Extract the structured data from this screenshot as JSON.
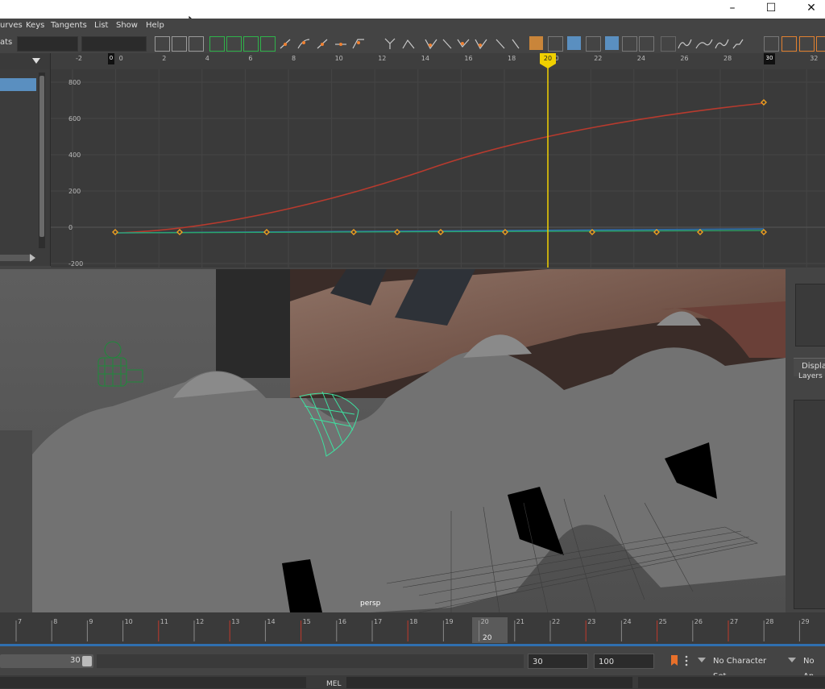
{
  "window": {
    "minimize_icon": "–",
    "maximize_icon": "☐",
    "close_icon": "✕"
  },
  "menubar": {
    "items": [
      "urves",
      "Keys",
      "Tangents",
      "List",
      "Show",
      "Help"
    ]
  },
  "toolbar": {
    "stats_label": "ats"
  },
  "graph": {
    "time_ticks": [
      "-2",
      "0",
      "2",
      "4",
      "6",
      "8",
      "10",
      "12",
      "14",
      "16",
      "18",
      "20",
      "22",
      "24",
      "26",
      "28",
      "30",
      "32"
    ],
    "value_ticks": [
      "800",
      "600",
      "400",
      "200",
      "0",
      "-200"
    ],
    "current_frame": "20",
    "start_marker": "0",
    "end_marker": "30"
  },
  "viewport": {
    "camera_label": "persp"
  },
  "right_panel": {
    "display_tab": "Displa",
    "layers_label": "Layers"
  },
  "timeslider": {
    "frames": [
      "7",
      "8",
      "9",
      "10",
      "11",
      "12",
      "13",
      "14",
      "15",
      "16",
      "17",
      "18",
      "19",
      "20",
      "21",
      "22",
      "23",
      "24",
      "25",
      "26",
      "27",
      "28",
      "29"
    ],
    "current": "20"
  },
  "range": {
    "slider_value": "30",
    "end_field": "30",
    "max_field": "100",
    "character_set": "No Character Set",
    "anim_layer": "No An"
  },
  "command_line": {
    "language": "MEL"
  },
  "colors": {
    "accent_yellow": "#f0d000",
    "curve_red": "#c0392b",
    "curve_green": "#2aa86a",
    "curve_blue": "#2f6fb0",
    "selection_blue": "#5a8fc0"
  }
}
